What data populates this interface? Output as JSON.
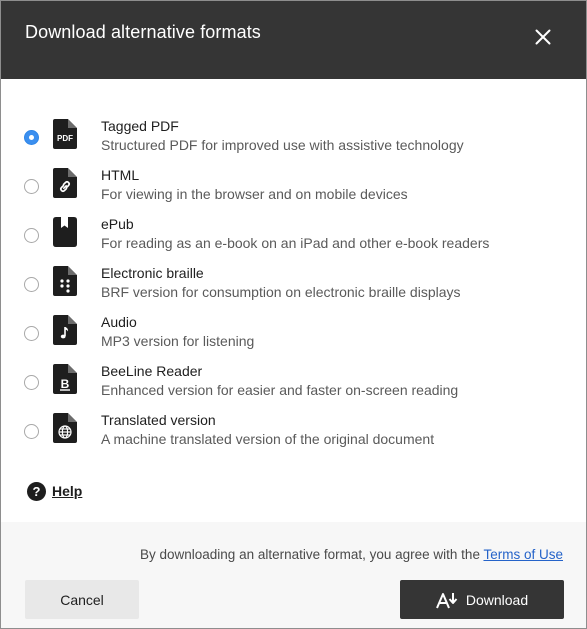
{
  "dialog": {
    "title": "Download alternative formats",
    "close_icon": "close-icon"
  },
  "options": [
    {
      "title": "Tagged PDF",
      "description": "Structured PDF for improved use with assistive technology",
      "icon": "pdf-file-icon",
      "icon_text": "PDF",
      "selected": true
    },
    {
      "title": "HTML",
      "description": "For viewing in the browser and on mobile devices",
      "icon": "link-file-icon",
      "selected": false
    },
    {
      "title": "ePub",
      "description": "For reading as an e-book on an iPad and other e-book readers",
      "icon": "book-icon",
      "selected": false
    },
    {
      "title": "Electronic braille",
      "description": "BRF version for consumption on electronic braille displays",
      "icon": "braille-file-icon",
      "selected": false
    },
    {
      "title": "Audio",
      "description": "MP3 version for listening",
      "icon": "audio-file-icon",
      "selected": false
    },
    {
      "title": "BeeLine Reader",
      "description": "Enhanced version for easier and faster on-screen reading",
      "icon": "beeline-file-icon",
      "icon_text": "B",
      "selected": false
    },
    {
      "title": "Translated version",
      "description": "A machine translated version of the original document",
      "icon": "globe-file-icon",
      "selected": false
    }
  ],
  "help": {
    "label": "Help",
    "icon": "help-icon"
  },
  "footer": {
    "terms_prefix": "By downloading an alternative format, you agree with the ",
    "terms_link": "Terms of Use",
    "cancel_label": "Cancel",
    "download_label": "Download",
    "download_icon": "accessible-download-icon"
  },
  "colors": {
    "header_bg": "#353535",
    "radio_selected": "#3b8fef",
    "link": "#2563c9",
    "footer_bg": "#f7f7f7",
    "primary_button_bg": "#353535",
    "secondary_button_bg": "#e8e8e8"
  }
}
